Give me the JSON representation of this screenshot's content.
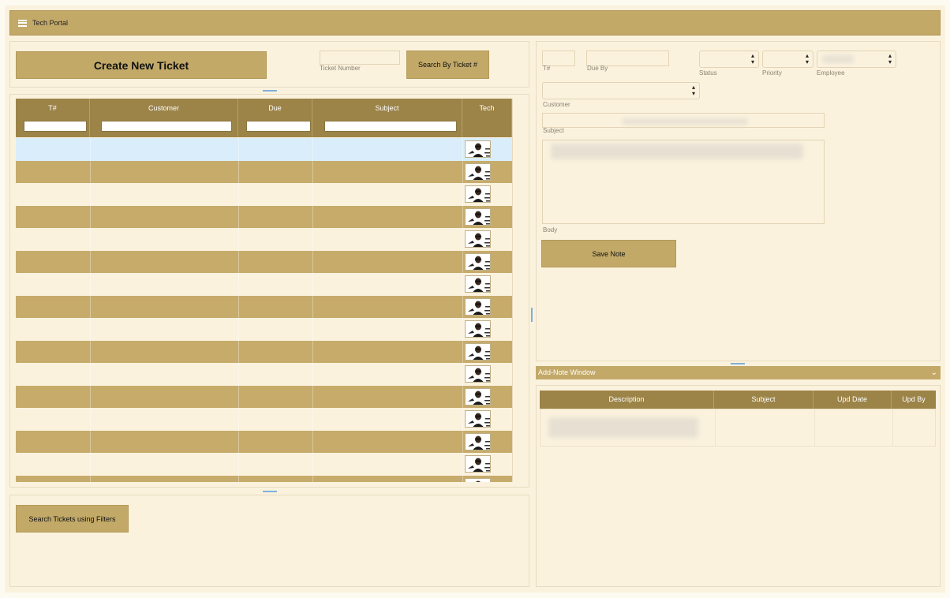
{
  "app": {
    "title": "Tech Portal"
  },
  "toolbar": {
    "create_label": "Create New Ticket",
    "ticket_number_label": "Ticket Number",
    "ticket_number_value": "",
    "search_by_ticket_label": "Search By Ticket #"
  },
  "grid": {
    "columns": [
      "T#",
      "Customer",
      "Due",
      "Subject",
      "Tech"
    ]
  },
  "detail": {
    "labels": {
      "ticket": "T#",
      "due_by": "Due By",
      "status": "Status",
      "priority": "Priority",
      "employee": "Employee",
      "customer": "Customer",
      "subject": "Subject",
      "body": "Body"
    },
    "save_note_label": "Save Note"
  },
  "notes": {
    "window_title": "Add-Note Window",
    "columns": [
      "Description",
      "Subject",
      "Upd Date",
      "Upd By"
    ]
  },
  "filters": {
    "search_label": "Search Tickets using Filters"
  }
}
